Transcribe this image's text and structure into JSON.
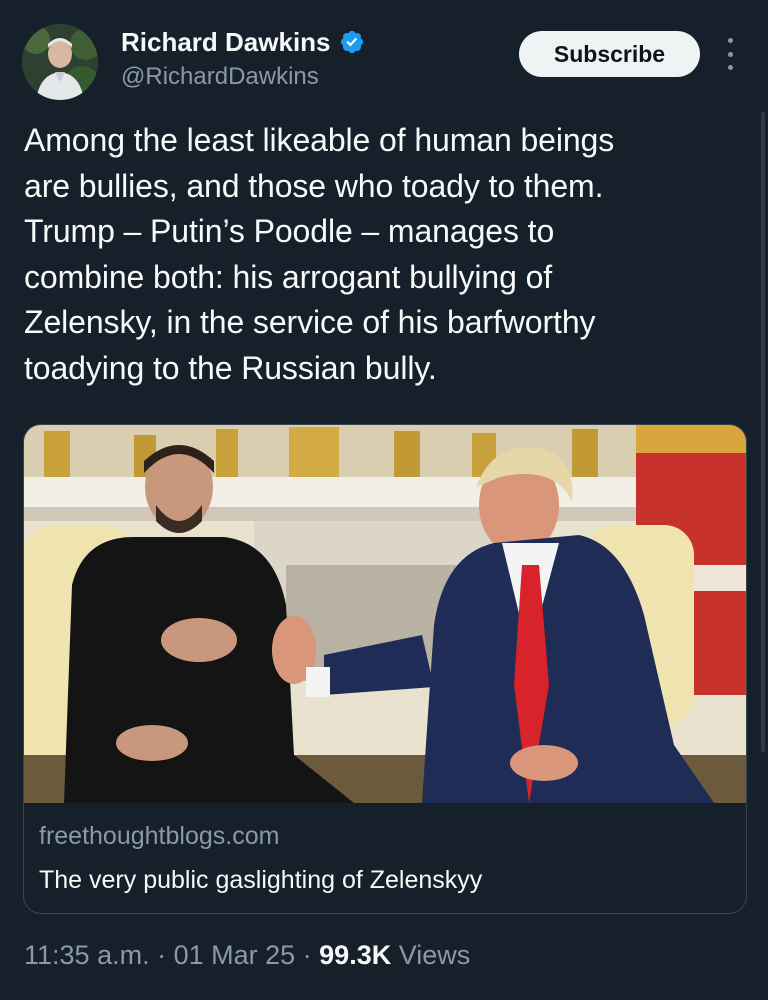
{
  "author": {
    "display_name": "Richard Dawkins",
    "handle": "@RichardDawkins",
    "verified_icon": "verified-badge-icon",
    "badge_color": "#1d9bf0"
  },
  "actions": {
    "subscribe_label": "Subscribe",
    "more_icon": "more-vertical-icon"
  },
  "tweet": {
    "text": "Among the least likeable of human beings\nare bullies, and those who toady to them.\nTrump – Putin’s Poodle – manages to\ncombine both: his arrogant bullying of\nZelensky, in the service of his barfworthy\ntoadying to the Russian bully."
  },
  "link_card": {
    "domain": "freethoughtblogs.com",
    "title": "The very public gaslighting of Zelenskyy",
    "image": "photo-two-men-seated-in-oval-office"
  },
  "meta": {
    "time": "11:35 a.m.",
    "separator": " · ",
    "date": "01 Mar 25",
    "views_count": "99.3K",
    "views_label": " Views"
  },
  "theme": {
    "background": "#15202b",
    "text": "#f7f9f9",
    "secondary_text": "#8b98a5",
    "border": "#38444d"
  }
}
